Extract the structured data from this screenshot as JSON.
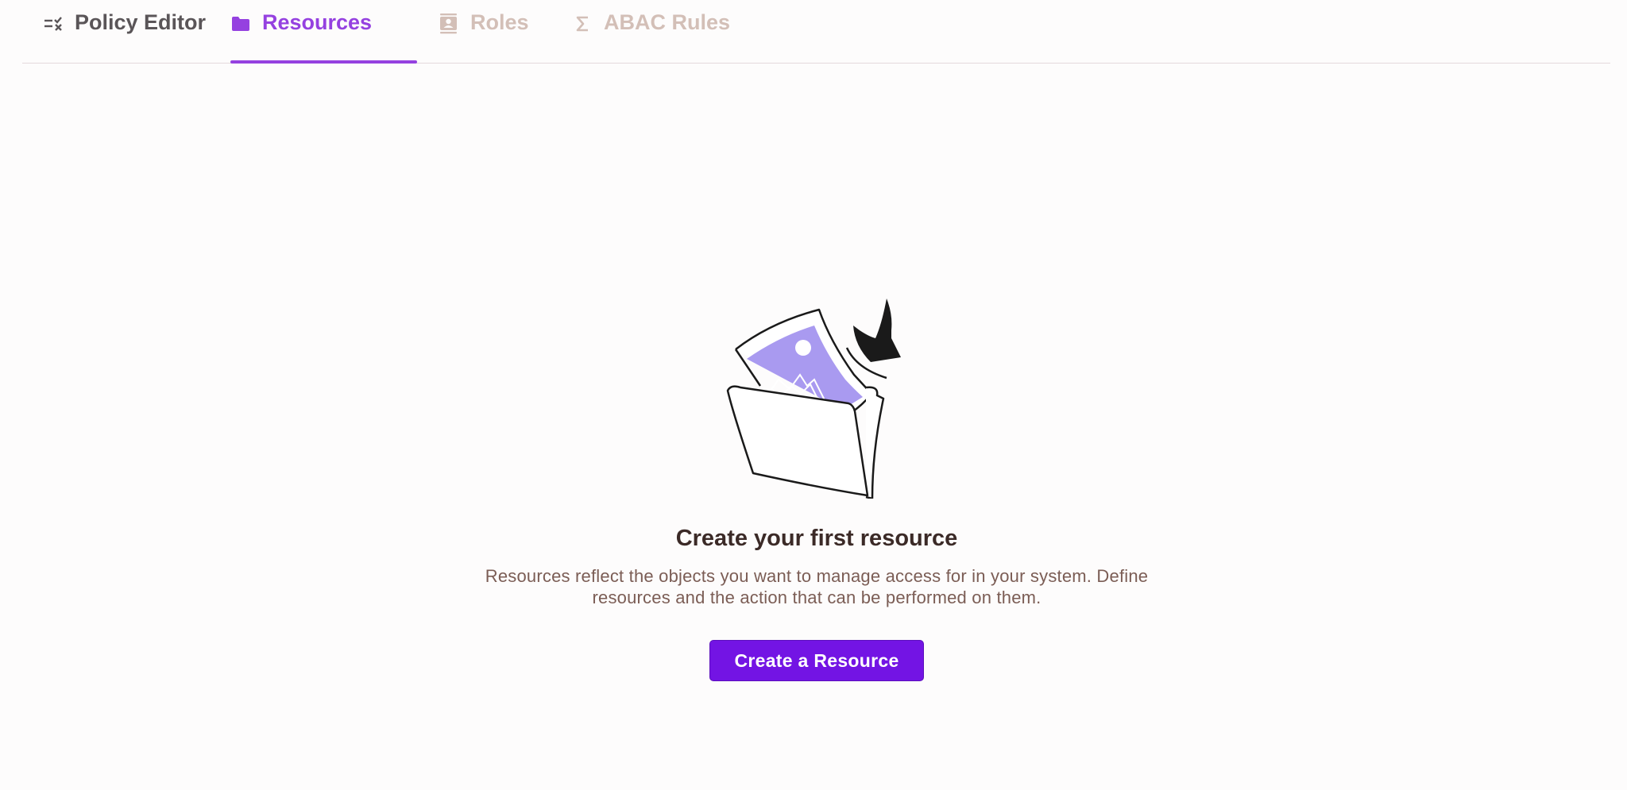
{
  "tabs": [
    {
      "label": "Policy Editor",
      "icon": "list-check-icon",
      "state": "default"
    },
    {
      "label": "Resources",
      "icon": "folder-icon",
      "state": "active"
    },
    {
      "label": "Roles",
      "icon": "contact-card-icon",
      "state": "disabled"
    },
    {
      "label": "ABAC Rules",
      "icon": "sigma-icon",
      "state": "disabled"
    }
  ],
  "empty_state": {
    "illustration": "folder-with-image-and-arrow",
    "title": "Create your first resource",
    "description": "Resources reflect the objects you want to manage access for in your system. Define resources and the action that can be performed on them.",
    "button_label": "Create a Resource"
  },
  "colors": {
    "accent": "#9541e0",
    "button": "#7314e4",
    "illustration_fill": "#a99af0",
    "disabled_tab": "#d3bfb7"
  }
}
